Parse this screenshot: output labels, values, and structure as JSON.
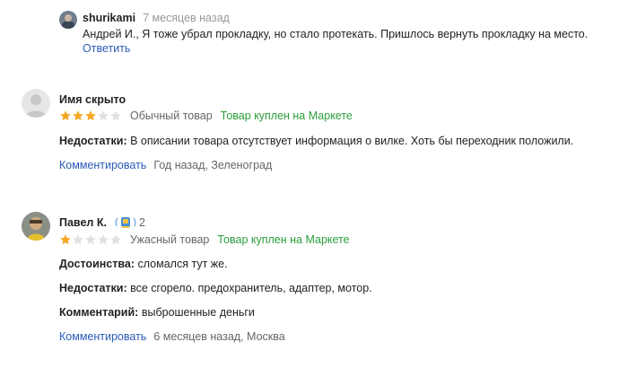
{
  "reply": {
    "author": "shurikami",
    "time": "7 месяцев назад",
    "text": "Андрей И., Я тоже убрал прокладку, но стало протекать. Пришлось вернуть прокладку на место.",
    "reply_label": "Ответить"
  },
  "reviews": [
    {
      "author": "Имя скрыто",
      "rating": 3,
      "rating_text": "Обычный товар",
      "purchase_badge": "Товар куплен на Маркете",
      "fields": [
        {
          "label": "Недостатки:",
          "value": "В описании товара отсутствует информация о вилке. Хоть бы переходник положили."
        }
      ],
      "comment_label": "Комментировать",
      "meta": "Год назад, Зеленоград"
    },
    {
      "author": "Павел К.",
      "level": "2",
      "rating": 1,
      "rating_text": "Ужасный товар",
      "purchase_badge": "Товар куплен на Маркете",
      "fields": [
        {
          "label": "Достоинства:",
          "value": "сломался тут же."
        },
        {
          "label": "Недостатки:",
          "value": "все сгорело. предохранитель, адаптер, мотор."
        },
        {
          "label": "Комментарий:",
          "value": "выброшенные деньги"
        }
      ],
      "comment_label": "Комментировать",
      "meta": "6 месяцев назад, Москва"
    }
  ],
  "colors": {
    "star_filled": "#f5a623",
    "star_empty": "#e0e0e0",
    "link": "#2b5cb8",
    "badge_green": "#2a9e3b"
  }
}
